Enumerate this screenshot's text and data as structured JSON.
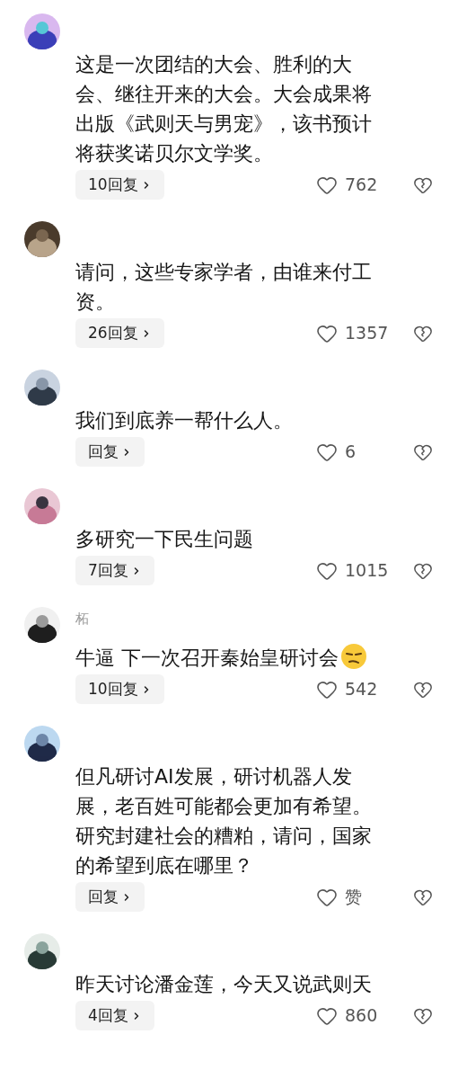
{
  "comments": [
    {
      "text": "这是一次团结的大会、胜利的大会、继往开来的大会。大会成果将出版《武则天与男宠》，该书预计将获奖诺贝尔文学奖。",
      "replies": "10回复",
      "likes": "762"
    },
    {
      "text": "请问，这些专家学者，由谁来付工资。",
      "replies": "26回复",
      "likes": "1357"
    },
    {
      "text": "我们到底养一帮什么人。",
      "replies": "回复",
      "likes": "6"
    },
    {
      "text": "多研究一下民生问题",
      "replies": "7回复",
      "likes": "1015"
    },
    {
      "username": "柘",
      "text": "牛逼 下一次召开秦始皇研讨会",
      "emoji": true,
      "replies": "10回复",
      "likes": "542"
    },
    {
      "text": "但凡研讨AI发展，研讨机器人发展，老百姓可能都会更加有希望。研究封建社会的糟粕，请问，国家的希望到底在哪里？",
      "replies": "回复",
      "likes": "赞"
    },
    {
      "text": "昨天讨论潘金莲，今天又说武则天",
      "replies": "4回复",
      "likes": "860"
    }
  ]
}
